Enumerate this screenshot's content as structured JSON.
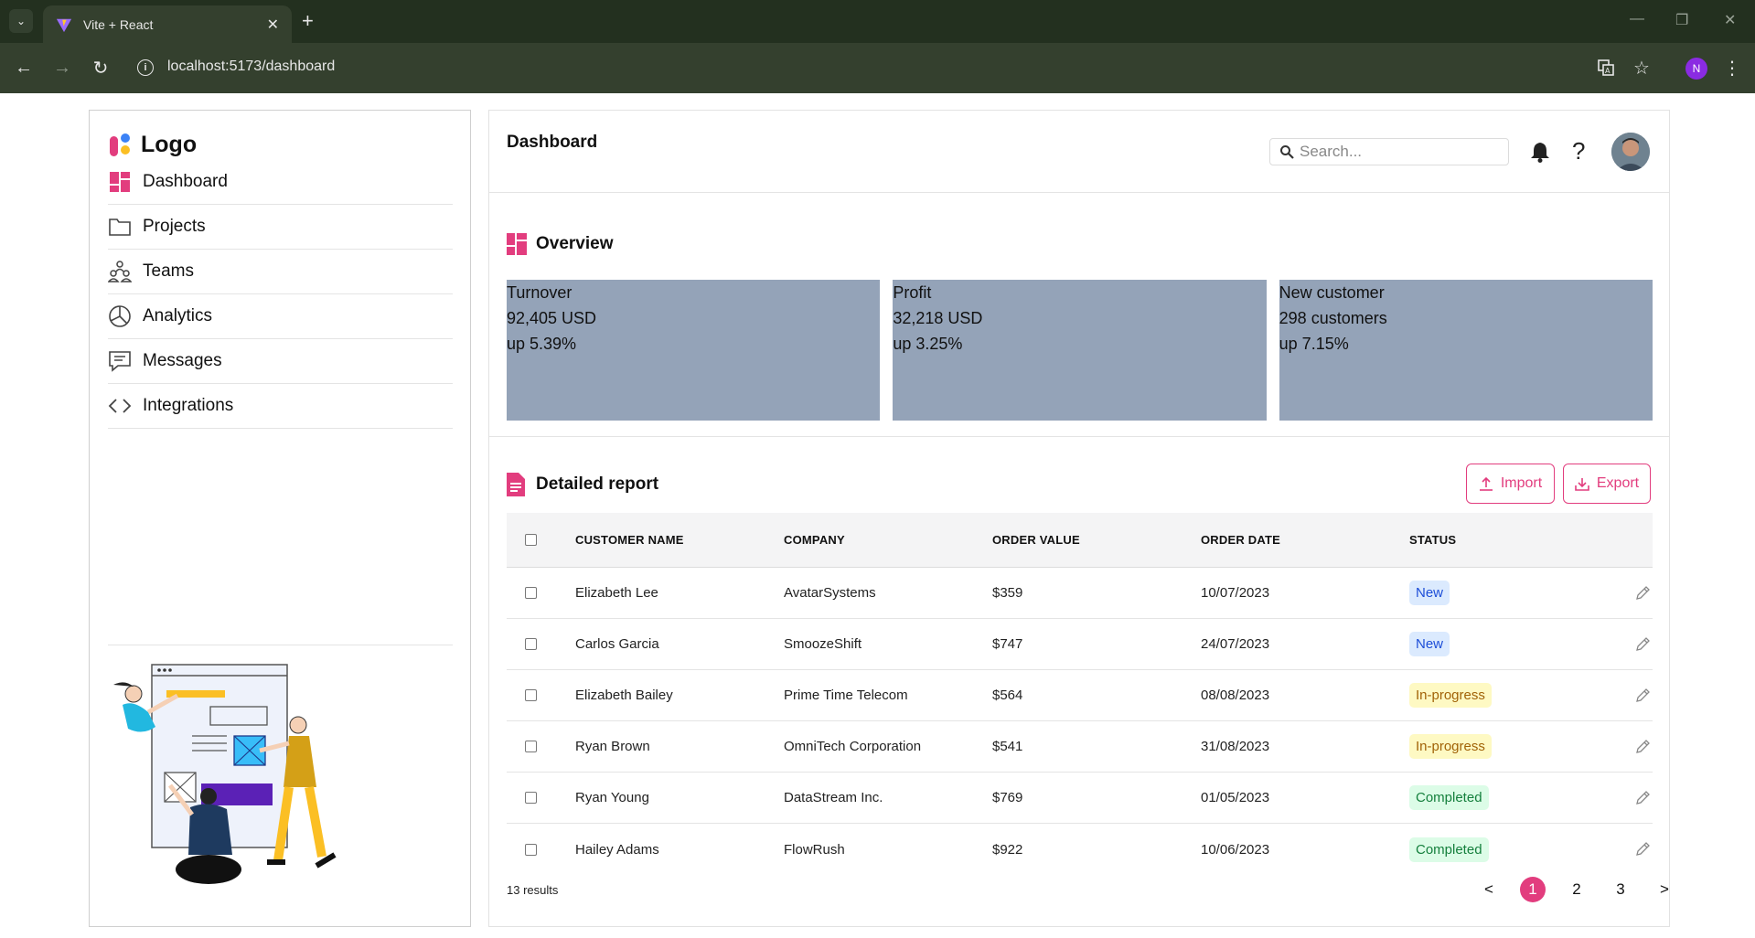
{
  "browser": {
    "tab_title": "Vite + React",
    "url": "localhost:5173/dashboard",
    "profile_initial": "N"
  },
  "sidebar": {
    "logo_text": "Logo",
    "items": [
      {
        "label": "Dashboard",
        "icon": "dashboard-icon"
      },
      {
        "label": "Projects",
        "icon": "folder-icon"
      },
      {
        "label": "Teams",
        "icon": "teams-icon"
      },
      {
        "label": "Analytics",
        "icon": "pie-chart-icon"
      },
      {
        "label": "Messages",
        "icon": "message-icon"
      },
      {
        "label": "Integrations",
        "icon": "code-icon"
      }
    ]
  },
  "header": {
    "title": "Dashboard",
    "search_placeholder": "Search..."
  },
  "overview": {
    "title": "Overview",
    "cards": [
      {
        "label": "Turnover",
        "value": "92,405 USD",
        "change": "up 5.39%"
      },
      {
        "label": "Profit",
        "value": "32,218 USD",
        "change": "up 3.25%"
      },
      {
        "label": "New customer",
        "value": "298 customers",
        "change": "up 7.15%"
      }
    ]
  },
  "report": {
    "title": "Detailed report",
    "import_label": "Import",
    "export_label": "Export",
    "columns": [
      "CUSTOMER NAME",
      "COMPANY",
      "ORDER VALUE",
      "ORDER DATE",
      "STATUS"
    ],
    "rows": [
      {
        "name": "Elizabeth Lee",
        "company": "AvatarSystems",
        "value": "$359",
        "date": "10/07/2023",
        "status": "New"
      },
      {
        "name": "Carlos Garcia",
        "company": "SmoozeShift",
        "value": "$747",
        "date": "24/07/2023",
        "status": "New"
      },
      {
        "name": "Elizabeth Bailey",
        "company": "Prime Time Telecom",
        "value": "$564",
        "date": "08/08/2023",
        "status": "In-progress"
      },
      {
        "name": "Ryan Brown",
        "company": "OmniTech Corporation",
        "value": "$541",
        "date": "31/08/2023",
        "status": "In-progress"
      },
      {
        "name": "Ryan Young",
        "company": "DataStream Inc.",
        "value": "$769",
        "date": "01/05/2023",
        "status": "Completed"
      },
      {
        "name": "Hailey Adams",
        "company": "FlowRush",
        "value": "$922",
        "date": "10/06/2023",
        "status": "Completed"
      }
    ],
    "results_text": "13 results",
    "pagination": {
      "prev": "<",
      "pages": [
        "1",
        "2",
        "3"
      ],
      "current": "1",
      "next": ">"
    }
  },
  "colors": {
    "accent": "#e23d7e",
    "card_bg": "#94a3b8",
    "chrome_dark": "#23301f",
    "chrome_bar": "#34402e"
  }
}
